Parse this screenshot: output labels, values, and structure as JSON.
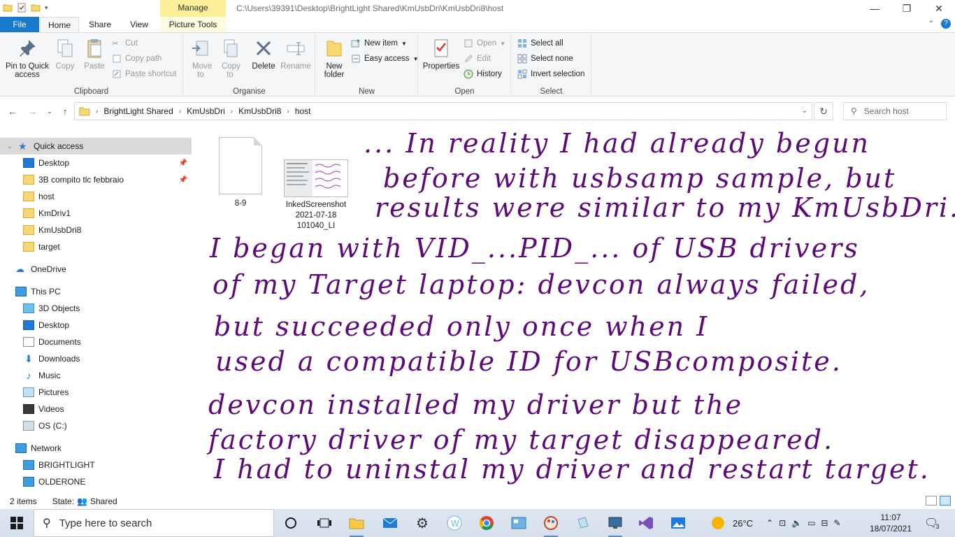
{
  "title_bar": {
    "context_tab": "Manage",
    "path": "C:\\Users\\39391\\Desktop\\BrightLight Shared\\KmUsbDri\\KmUsbDri8\\host"
  },
  "ribbon_tabs": {
    "file": "File",
    "home": "Home",
    "share": "Share",
    "view": "View",
    "picture_tools": "Picture Tools"
  },
  "clipboard": {
    "pin": "Pin to Quick access",
    "copy": "Copy",
    "paste": "Paste",
    "cut": "Cut",
    "copy_path": "Copy path",
    "paste_shortcut": "Paste shortcut",
    "label": "Clipboard"
  },
  "organise": {
    "move_to": "Move to",
    "copy_to": "Copy to",
    "delete": "Delete",
    "rename": "Rename",
    "label": "Organise"
  },
  "new_group": {
    "new_folder": "New folder",
    "new_item": "New item",
    "easy_access": "Easy access",
    "label": "New"
  },
  "open_group": {
    "properties": "Properties",
    "open": "Open",
    "edit": "Edit",
    "history": "History",
    "label": "Open"
  },
  "select_group": {
    "select_all": "Select all",
    "select_none": "Select none",
    "invert": "Invert selection",
    "label": "Select"
  },
  "breadcrumb": [
    "BrightLight Shared",
    "KmUsbDri",
    "KmUsbDri8",
    "host"
  ],
  "search": {
    "placeholder": "Search host"
  },
  "nav_pane": {
    "quick_access": "Quick access",
    "quick_items": [
      "Desktop",
      "3B compito tlc febbraio",
      "host",
      "KmDriv1",
      "KmUsbDri8",
      "target"
    ],
    "onedrive": "OneDrive",
    "this_pc": "This PC",
    "pc_items": [
      "3D Objects",
      "Desktop",
      "Documents",
      "Downloads",
      "Music",
      "Pictures",
      "Videos",
      "OS (C:)"
    ],
    "network": "Network",
    "network_items": [
      "BRIGHTLIGHT",
      "OLDERONE"
    ]
  },
  "files": [
    {
      "name": "8-9"
    },
    {
      "name": "InkedScreenshot 2021-07-18 101040_LI"
    }
  ],
  "handwriting": [
    "... In reality I had already begun",
    "before with usbsamp sample, but",
    "results were similar to my KmUsbDri.",
    "I began with VID_...PID_... of USB drivers",
    "of my Target laptop: devcon always failed,",
    "but succeeded only once when I",
    "used a compatible ID for USBcomposite.",
    "devcon installed my driver but the",
    "factory driver of my target disappeared.",
    "I had to uninstal my driver and restart target."
  ],
  "status": {
    "items": "2 items",
    "state_label": "State:",
    "state_value": "Shared"
  },
  "taskbar": {
    "search_placeholder": "Type here to search",
    "temperature": "26°C",
    "time": "11:07",
    "date": "18/07/2021",
    "notifications": "3"
  },
  "colors": {
    "ink": "#5c0a7a",
    "accent": "#1979ca",
    "manage_tab": "#fbef9a"
  }
}
